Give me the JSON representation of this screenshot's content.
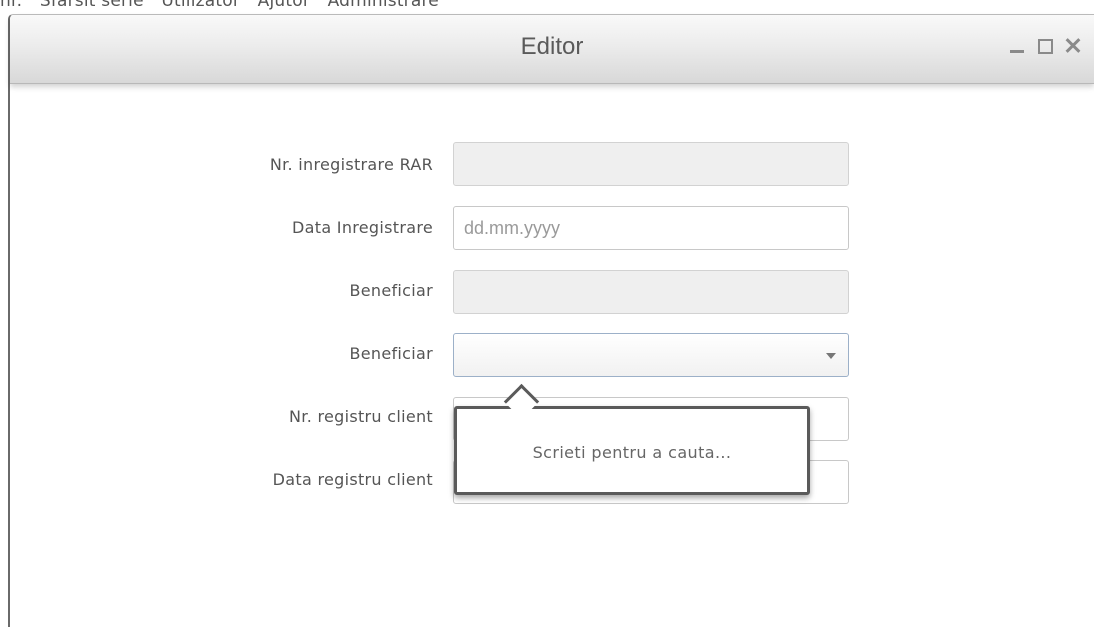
{
  "background_menu": [
    "nr.",
    "Sfarsit serie",
    "Utilizator",
    "Ajutor",
    "Administrare"
  ],
  "window": {
    "title": "Editor",
    "controls": {
      "minimize_icon": "minimize-icon",
      "maximize_icon": "maximize-icon",
      "close_icon": "close-icon"
    }
  },
  "form": {
    "fields": [
      {
        "label": "Nr. inregistrare RAR",
        "value": "",
        "placeholder": "",
        "state": "disabled"
      },
      {
        "label": "Data Inregistrare",
        "value": "",
        "placeholder": "dd.mm.yyyy",
        "state": "enabled"
      },
      {
        "label": "Beneficiar",
        "value": "",
        "placeholder": "",
        "state": "disabled"
      },
      {
        "label": "Beneficiar",
        "value": "",
        "placeholder": "",
        "state": "combo-focused"
      },
      {
        "label": "Nr. registru client",
        "value": "",
        "placeholder": "",
        "state": "enabled"
      },
      {
        "label": "Data registru client",
        "value": "",
        "placeholder": "",
        "state": "enabled"
      }
    ]
  },
  "popover": {
    "text": "Scrieti pentru a cauta..."
  }
}
